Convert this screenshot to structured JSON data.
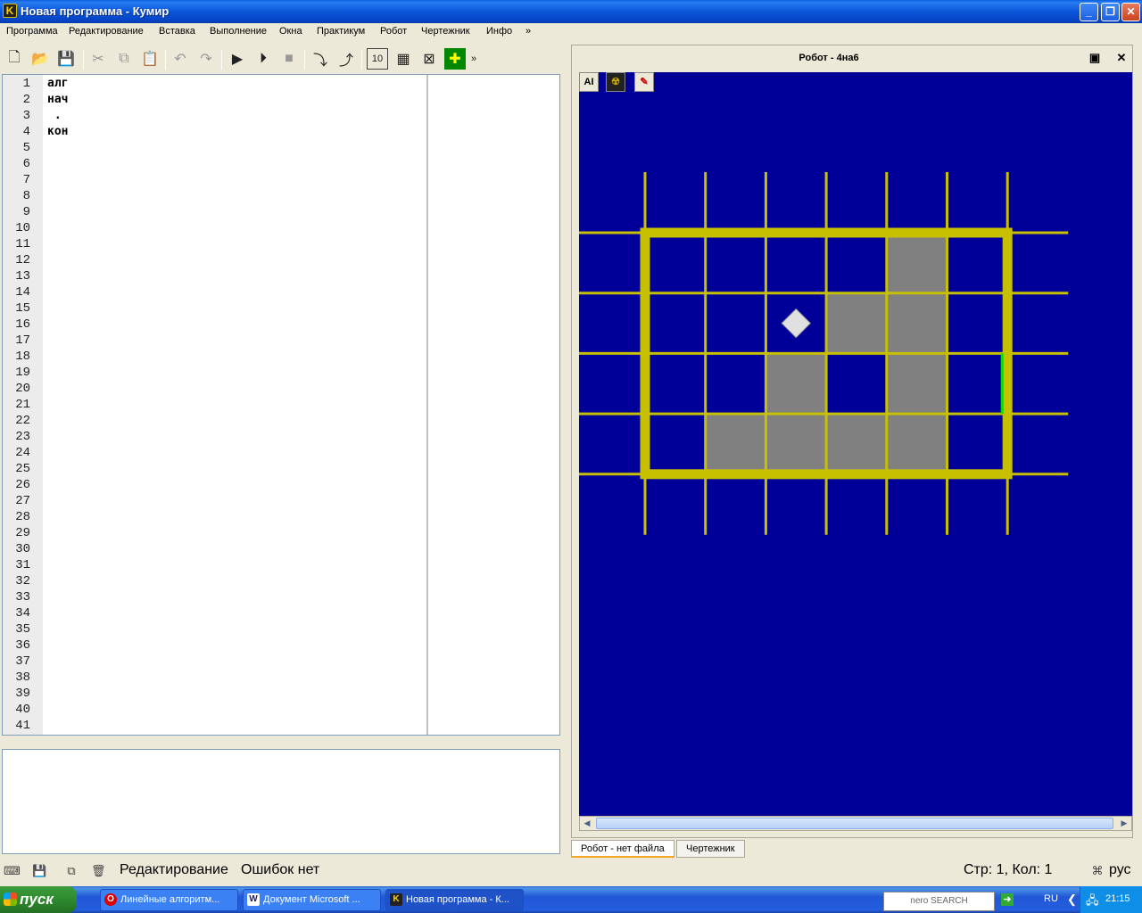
{
  "window": {
    "title": "Новая программа - Кумир",
    "app_icon_letter": "K"
  },
  "menu": [
    "Программа",
    "Редактирование",
    "Вставка",
    "Выполнение",
    "Окна",
    "Практикум",
    "Робот",
    "Чертежник",
    "Инфо",
    "»"
  ],
  "toolbar": {
    "icons": [
      "new-file-icon",
      "open-folder-icon",
      "save-icon",
      "cut-icon",
      "copy-icon",
      "paste-icon",
      "undo-icon",
      "redo-icon",
      "run-icon",
      "step-run-icon",
      "stop-icon",
      "step-into-icon",
      "step-out-icon",
      "numbers-icon",
      "grid-icon",
      "robot-icon",
      "drawer-icon"
    ],
    "overflow": "»",
    "numbers_glyph": "10"
  },
  "editor": {
    "line_count": 41,
    "lines": [
      "алг",
      "нач",
      " .",
      "кон",
      ""
    ]
  },
  "robot_window": {
    "title": "Робот - 4на6",
    "tool_icons": [
      "AI",
      "☢",
      "✎"
    ],
    "colors": {
      "field": "#000099",
      "grid": "#c7c000",
      "painted": "#808080",
      "robot": "#e0e0e0",
      "marker": "#00e000"
    },
    "cols": 6,
    "rows": 4,
    "painted_cells": [
      [
        4,
        0
      ],
      [
        3,
        1
      ],
      [
        4,
        1
      ],
      [
        2,
        2
      ],
      [
        4,
        2
      ],
      [
        1,
        3
      ],
      [
        2,
        3
      ],
      [
        3,
        3
      ],
      [
        4,
        3
      ]
    ],
    "robot_cell": [
      2,
      1
    ]
  },
  "tabs": [
    "Робот - нет файла",
    "Чертежник"
  ],
  "status": {
    "mode": "Редактирование",
    "errors": "Ошибок нет",
    "position": "Стр: 1, Кол: 1",
    "lang": "рус"
  },
  "taskbar": {
    "start": "пуск",
    "tasks": [
      "Линейные алгоритм...",
      "Документ Microsoft ...",
      "Новая программа - К..."
    ],
    "tray_lang": "RU",
    "clock": "21:15",
    "nero": "nero SEARCH"
  }
}
